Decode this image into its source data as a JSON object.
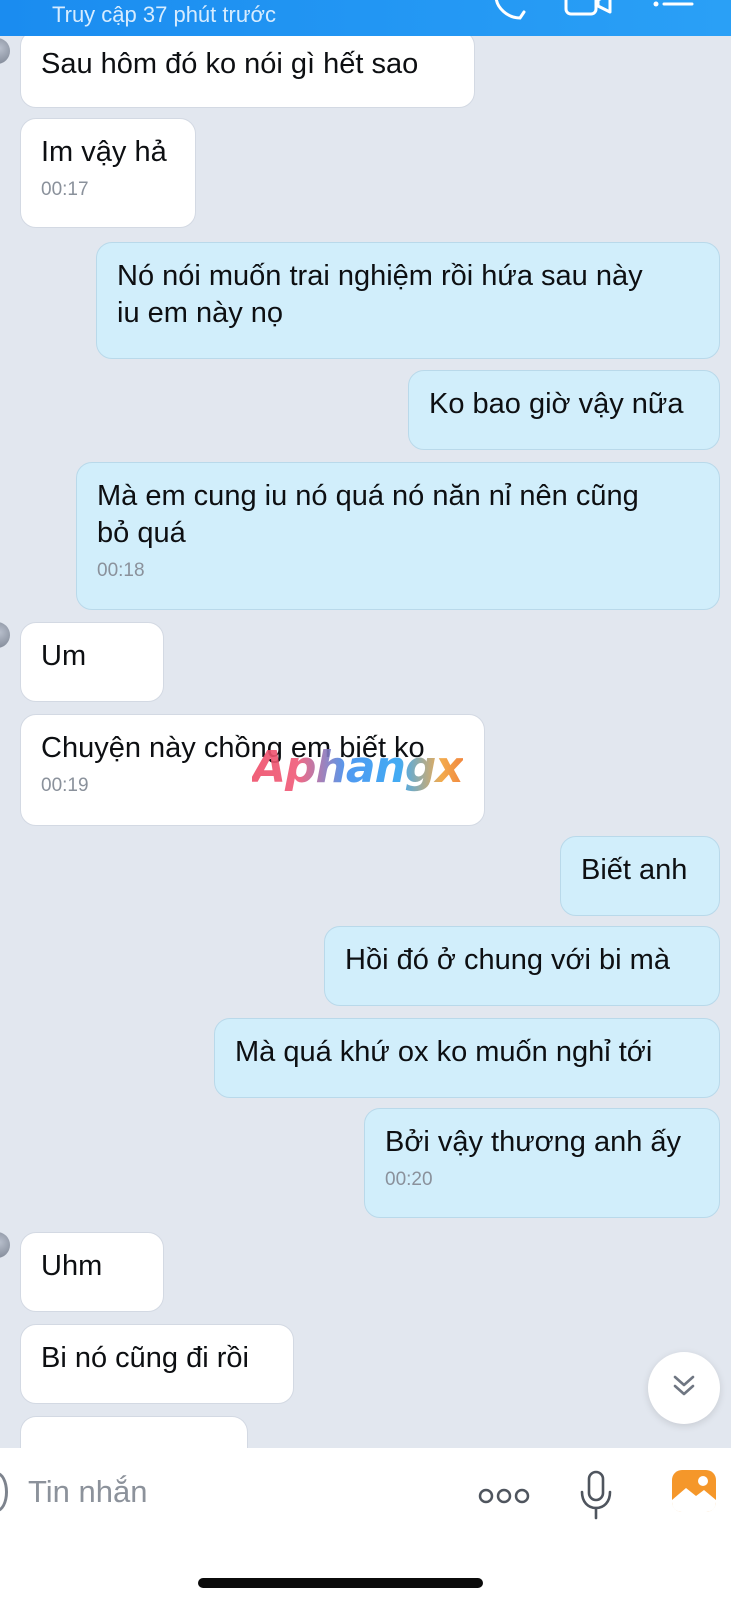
{
  "header": {
    "status": "Truy cập 37 phút trước",
    "icons": [
      "phone-call-icon",
      "video-call-icon",
      "menu-list-icon"
    ],
    "background": "#1a8cf0"
  },
  "messages": [
    {
      "side": "in",
      "text": "Sau hôm đó ko nói gì hết sao",
      "time": ""
    },
    {
      "side": "in",
      "text": "Im vậy hả",
      "time": "00:17"
    },
    {
      "side": "out",
      "text": "Nó nói muốn trai nghiệm rồi hứa sau này\niu em này nọ",
      "time": ""
    },
    {
      "side": "out",
      "text": "Ko bao giờ vậy nữa",
      "time": ""
    },
    {
      "side": "out",
      "text": "Mà em cung iu nó quá nó năn nỉ nên cũng\nbỏ quá",
      "time": "00:18"
    },
    {
      "side": "in",
      "text": "Um",
      "time": ""
    },
    {
      "side": "in",
      "text": "Chuyện này chồng em biết ko",
      "time": "00:19"
    },
    {
      "side": "out",
      "text": "Biết anh",
      "time": ""
    },
    {
      "side": "out",
      "text": "Hồi đó ở chung với bi mà",
      "time": ""
    },
    {
      "side": "out",
      "text": "Mà quá khứ ox ko muốn nghỉ tới",
      "time": ""
    },
    {
      "side": "out",
      "text": "Bởi vậy thương anh ấy",
      "time": "00:20"
    },
    {
      "side": "in",
      "text": "Uhm",
      "time": ""
    },
    {
      "side": "in",
      "text": "Bi nó cũng đi rồi",
      "time": ""
    }
  ],
  "watermark": "Aphangx",
  "composer": {
    "placeholder": "Tin nhắn",
    "icons": [
      "more-dots-icon",
      "microphone-icon",
      "photo-gallery-icon"
    ],
    "accent": "#f5972a"
  },
  "colors": {
    "incoming_bubble": "#ffffff",
    "outgoing_bubble": "#d1eefb",
    "chat_background": "#e2e7ef"
  }
}
